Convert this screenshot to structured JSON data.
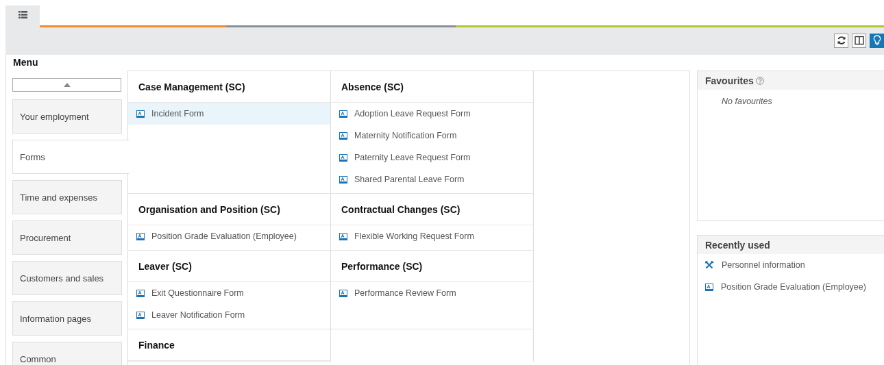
{
  "toolbar_buttons": [
    {
      "kind": "refresh",
      "selected": false
    },
    {
      "kind": "columns",
      "selected": false
    },
    {
      "kind": "lightbulb",
      "selected": true
    }
  ],
  "menu_title": "Menu",
  "nav_items": [
    {
      "label": "Your employment",
      "selected": false
    },
    {
      "label": "Forms",
      "selected": true
    },
    {
      "label": "Time and expenses",
      "selected": false
    },
    {
      "label": "Procurement",
      "selected": false
    },
    {
      "label": "Customers and sales",
      "selected": false
    },
    {
      "label": "Information pages",
      "selected": false
    },
    {
      "label": "Common",
      "selected": false
    }
  ],
  "group_rows": [
    [
      {
        "title": "Case Management (SC)",
        "items": [
          {
            "label": "Incident Form",
            "selected": true
          }
        ]
      },
      {
        "title": "Absence (SC)",
        "items": [
          {
            "label": "Adoption Leave Request Form",
            "selected": false
          },
          {
            "label": "Maternity Notification Form",
            "selected": false
          },
          {
            "label": "Paternity Leave Request Form",
            "selected": false
          },
          {
            "label": "Shared Parental Leave Form",
            "selected": false
          }
        ]
      }
    ],
    [
      {
        "title": "Organisation and Position (SC)",
        "items": [
          {
            "label": "Position Grade Evaluation (Employee)",
            "selected": false
          }
        ]
      },
      {
        "title": "Contractual Changes (SC)",
        "items": [
          {
            "label": "Flexible Working Request Form",
            "selected": false
          }
        ]
      }
    ],
    [
      {
        "title": "Leaver (SC)",
        "items": [
          {
            "label": "Exit Questionnaire Form",
            "selected": false
          },
          {
            "label": "Leaver Notification Form",
            "selected": false
          }
        ]
      },
      {
        "title": "Performance (SC)",
        "items": [
          {
            "label": "Performance Review Form",
            "selected": false
          }
        ]
      }
    ],
    [
      {
        "title": "Finance"
      }
    ]
  ],
  "favourites": {
    "title": "Favourites",
    "empty_text": "No favourites"
  },
  "recently_used": {
    "title": "Recently used",
    "items": [
      {
        "kind": "tools",
        "label": "Personnel information"
      },
      {
        "kind": "form",
        "label": "Position Grade Evaluation (Employee)"
      }
    ]
  }
}
